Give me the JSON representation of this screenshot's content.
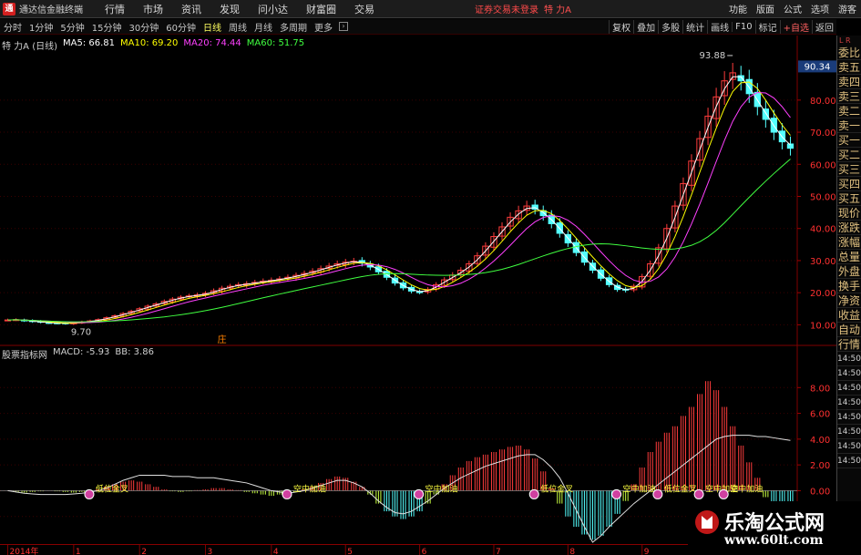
{
  "app": {
    "title": "通达信金融终端",
    "login_status": "证券交易未登录",
    "stock_top": "特 力A",
    "guest": "游客"
  },
  "menu": [
    "行情",
    "市场",
    "资讯",
    "发现",
    "问小达",
    "财富圈",
    "交易"
  ],
  "right_menu": [
    "功能",
    "版面",
    "公式",
    "选项"
  ],
  "toolbar": {
    "periods": [
      "分时",
      "1分钟",
      "5分钟",
      "15分钟",
      "30分钟",
      "60分钟",
      "日线",
      "周线",
      "月线",
      "多周期",
      "更多"
    ],
    "active_period": "日线",
    "right": [
      "复权",
      "叠加",
      "多股",
      "统计",
      "画线",
      "F10",
      "标记",
      "+自选",
      "返回"
    ]
  },
  "price_info": {
    "name": "特 力A (日线)",
    "ma5": "MA5: 66.81",
    "ma10": "MA10: 69.20",
    "ma20": "MA20: 74.44",
    "ma60": "MA60: 51.75"
  },
  "macd_info": {
    "name": "股票指标网",
    "macd": "MACD: -5.93",
    "bb": "BB: 3.86"
  },
  "price_axis": {
    "current": "90.34",
    "ticks": [
      "80.00",
      "70.00",
      "60.00",
      "50.00",
      "40.00",
      "30.00",
      "20.00",
      "10.00"
    ]
  },
  "price_annotations": {
    "high": "93.88",
    "low": "9.70",
    "marker": "庄"
  },
  "macd_axis": {
    "ticks": [
      "8.00",
      "6.00",
      "4.00",
      "2.00",
      "0.00",
      "-2.00"
    ]
  },
  "signals": [
    "低位金叉",
    "空中加油",
    "空中加油",
    "低位金叉",
    "空中加油",
    "低位金叉",
    "空中加油",
    "空中加油"
  ],
  "date_axis": [
    "2014年",
    "1",
    "2",
    "3",
    "4",
    "5",
    "6",
    "7",
    "8",
    "9",
    "201"
  ],
  "right_panel": {
    "top": "L R",
    "items": [
      "委比",
      "卖五",
      "卖四",
      "卖三",
      "卖二",
      "卖一",
      "买一",
      "买二",
      "买三",
      "买四",
      "买五",
      "现价",
      "涨跌",
      "涨幅",
      "总量",
      "外盘",
      "换手",
      "净资",
      "收益",
      "自动",
      "行情",
      "14:50",
      "14:50",
      "14:50",
      "14:50",
      "14:50",
      "14:50",
      "14:50",
      "14:50"
    ]
  },
  "watermark": {
    "text": "乐淘公式网",
    "url": "www.60lt.com"
  },
  "chart_data": {
    "type": "line",
    "title": "",
    "price_range": [
      5,
      95
    ],
    "macd_range": [
      -4,
      10
    ],
    "closes": [
      11.5,
      11.6,
      11.3,
      11.0,
      10.8,
      10.6,
      10.5,
      10.4,
      10.6,
      10.9,
      11.2,
      11.6,
      12.2,
      12.8,
      13.5,
      14.2,
      15.0,
      15.8,
      16.5,
      17.3,
      18.0,
      18.6,
      19.0,
      19.3,
      19.8,
      20.6,
      21.4,
      22.0,
      22.5,
      22.8,
      23.2,
      23.6,
      23.9,
      24.3,
      24.8,
      25.4,
      26.0,
      26.7,
      27.5,
      28.3,
      29.0,
      29.5,
      29.8,
      29.2,
      28.0,
      26.5,
      24.8,
      23.0,
      21.5,
      20.5,
      20.2,
      21.0,
      22.5,
      24.0,
      25.5,
      27.0,
      29.0,
      31.5,
      34.5,
      37.5,
      40.5,
      43.5,
      45.5,
      47.0,
      46.0,
      44.0,
      41.5,
      38.5,
      35.5,
      32.5,
      29.5,
      27.0,
      24.5,
      22.5,
      21.0,
      20.8,
      22.0,
      25.0,
      29.0,
      34.0,
      40.0,
      47.0,
      54.0,
      61.0,
      68.0,
      75.0,
      81.0,
      86.0,
      88.5,
      86.0,
      82.0,
      78.0,
      74.0,
      70.0,
      67.0,
      65.0
    ],
    "macd_bars": [
      0.0,
      -0.1,
      -0.15,
      -0.1,
      -0.05,
      0.0,
      -0.05,
      -0.1,
      -0.15,
      -0.1,
      -0.05,
      0.1,
      0.3,
      0.5,
      0.7,
      0.8,
      0.7,
      0.5,
      0.3,
      0.1,
      -0.05,
      -0.1,
      -0.05,
      0.05,
      0.1,
      0.2,
      0.2,
      0.1,
      0.05,
      -0.1,
      -0.2,
      -0.3,
      -0.4,
      -0.3,
      -0.2,
      -0.1,
      0.1,
      0.3,
      0.6,
      0.9,
      1.1,
      1.0,
      0.7,
      0.3,
      -0.3,
      -1.0,
      -1.6,
      -2.0,
      -2.2,
      -2.0,
      -1.6,
      -1.0,
      -0.3,
      0.5,
      1.2,
      1.8,
      2.3,
      2.6,
      2.8,
      3.0,
      3.2,
      3.4,
      3.5,
      3.2,
      2.5,
      1.5,
      0.2,
      -1.0,
      -2.0,
      -2.8,
      -3.4,
      -3.8,
      -3.5,
      -2.8,
      -1.8,
      -0.8,
      0.5,
      1.8,
      3.0,
      3.8,
      4.5,
      5.0,
      5.8,
      6.5,
      7.5,
      8.5,
      7.8,
      6.5,
      5.0,
      3.5,
      2.2,
      1.0,
      -0.5,
      -1.2,
      -1.8,
      -2.0
    ],
    "bb_line": [
      0.0,
      -0.1,
      -0.2,
      -0.25,
      -0.3,
      -0.3,
      -0.3,
      -0.3,
      -0.25,
      -0.2,
      -0.1,
      0.0,
      0.2,
      0.5,
      0.8,
      1.0,
      1.2,
      1.2,
      1.2,
      1.2,
      1.1,
      1.1,
      1.1,
      1.0,
      1.0,
      1.0,
      0.9,
      0.8,
      0.7,
      0.6,
      0.4,
      0.2,
      0.0,
      -0.1,
      -0.2,
      -0.1,
      0.0,
      0.2,
      0.4,
      0.6,
      0.8,
      0.8,
      0.6,
      0.3,
      -0.2,
      -0.8,
      -1.3,
      -1.7,
      -1.8,
      -1.6,
      -1.2,
      -0.8,
      -0.3,
      0.2,
      0.6,
      1.0,
      1.3,
      1.6,
      1.9,
      2.1,
      2.3,
      2.5,
      2.7,
      2.8,
      2.8,
      2.4,
      1.8,
      1.0,
      -0.2,
      -1.5,
      -2.8,
      -4.0,
      -3.5,
      -2.8,
      -2.2,
      -1.6,
      -1.0,
      -0.5,
      0.0,
      0.5,
      1.0,
      1.5,
      2.0,
      2.5,
      3.0,
      3.5,
      4.0,
      4.2,
      4.3,
      4.3,
      4.3,
      4.2,
      4.2,
      4.1,
      4.0,
      3.9
    ]
  }
}
